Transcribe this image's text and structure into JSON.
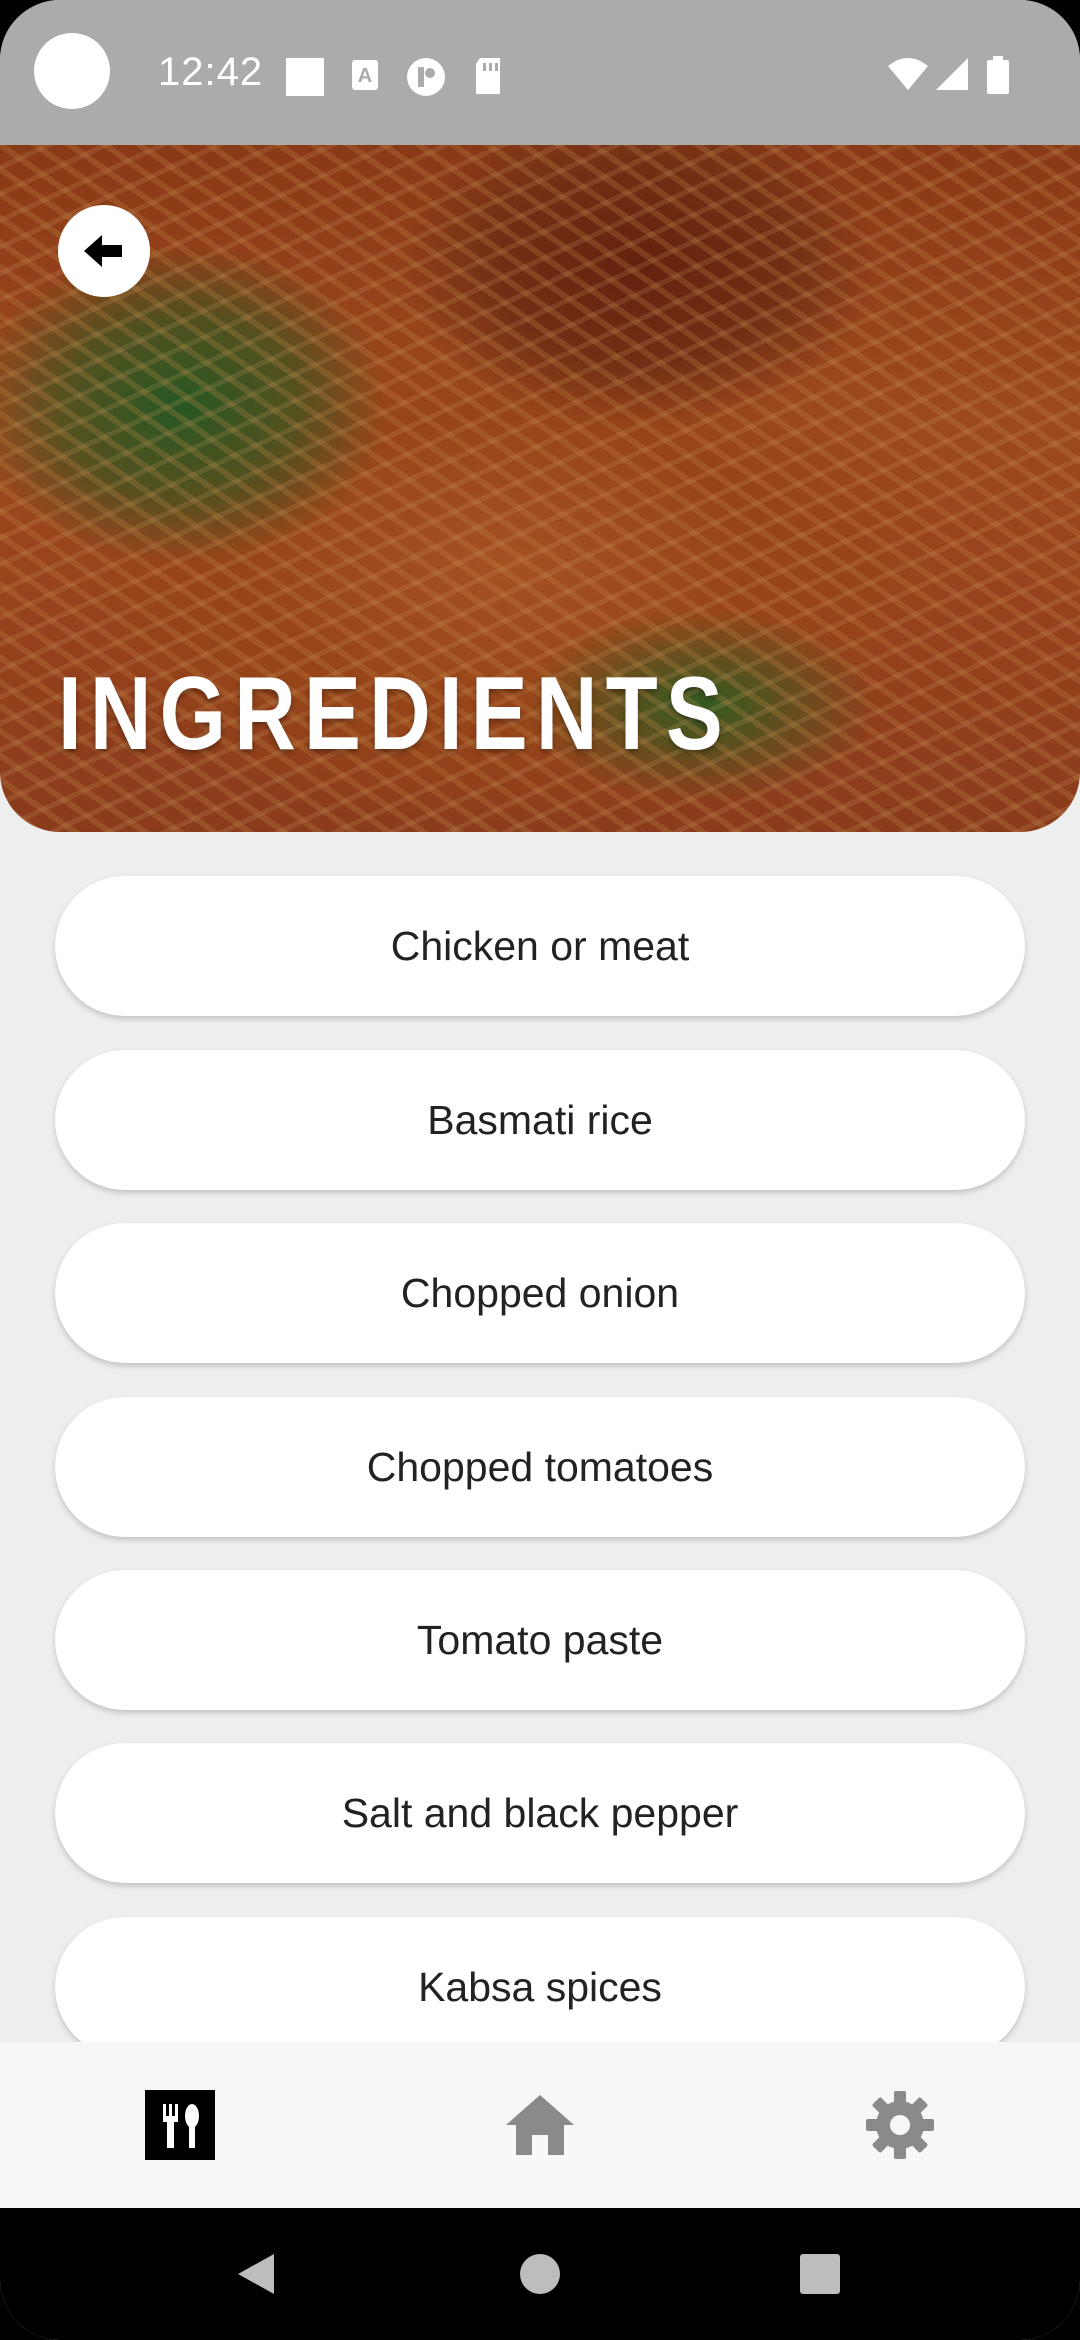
{
  "status_bar": {
    "time": "12:42",
    "icons": [
      "notification-square-icon",
      "text-a-icon",
      "badge-icon",
      "sd-card-icon",
      "wifi-icon",
      "signal-icon",
      "battery-icon"
    ]
  },
  "header": {
    "title": "INGREDIENTS",
    "back_icon": "arrow-left-icon"
  },
  "ingredients": [
    "Chicken or meat",
    "Basmati rice",
    "Chopped onion",
    "Chopped tomatoes",
    "Tomato paste",
    "Salt and black pepper",
    "Kabsa spices"
  ],
  "bottom_nav": {
    "items": [
      {
        "icon": "restaurant-icon",
        "selected": true
      },
      {
        "icon": "home-icon",
        "selected": false
      },
      {
        "icon": "settings-icon",
        "selected": false
      }
    ]
  },
  "system_nav": [
    "back-icon",
    "home-circle-icon",
    "recents-icon"
  ],
  "colors": {
    "status_bar": "#ababab",
    "background": "#eeeeee",
    "card": "#ffffff",
    "nav_icon_inactive": "#8a8a8a",
    "nav_icon_active": "#000000"
  }
}
